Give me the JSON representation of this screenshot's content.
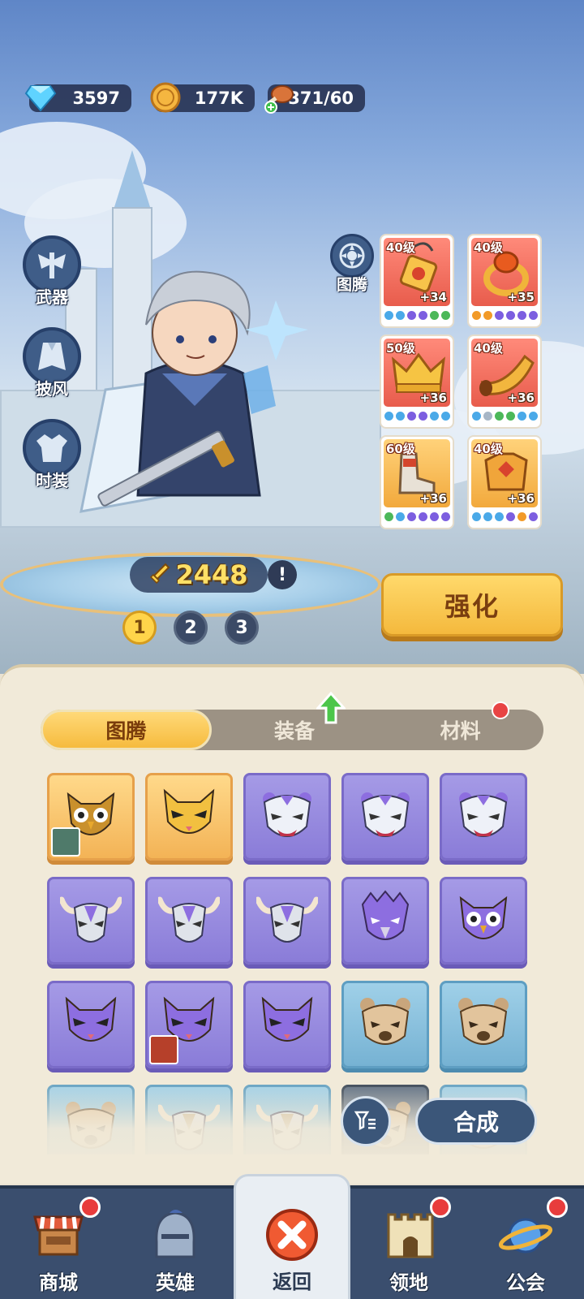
{
  "resources": {
    "diamonds": "3597",
    "gold": "177K",
    "stamina": "371/60"
  },
  "side_menu": {
    "weapon": "武器",
    "cloak": "披风",
    "costume": "时装",
    "totem": "图腾"
  },
  "equipment": [
    {
      "level": "40级",
      "bonus": "+34",
      "rarity": "red"
    },
    {
      "level": "40级",
      "bonus": "+35",
      "rarity": "red"
    },
    {
      "level": "50级",
      "bonus": "+36",
      "rarity": "red"
    },
    {
      "level": "40级",
      "bonus": "+36",
      "rarity": "red"
    },
    {
      "level": "60级",
      "bonus": "+36",
      "rarity": "gold"
    },
    {
      "level": "40级",
      "bonus": "+36",
      "rarity": "gold"
    }
  ],
  "power": "2448",
  "info": "!",
  "pages": [
    "1",
    "2",
    "3"
  ],
  "strengthen_label": "强化",
  "tabs": [
    "图腾",
    "装备",
    "材料"
  ],
  "grid": [
    {
      "mask": "owl",
      "tier": "orange",
      "hero": true
    },
    {
      "mask": "cat",
      "tier": "orange"
    },
    {
      "mask": "tiger",
      "tier": "purple"
    },
    {
      "mask": "tiger",
      "tier": "purple"
    },
    {
      "mask": "tiger",
      "tier": "purple"
    },
    {
      "mask": "bull",
      "tier": "purple"
    },
    {
      "mask": "bull",
      "tier": "purple"
    },
    {
      "mask": "bull",
      "tier": "purple"
    },
    {
      "mask": "eagle",
      "tier": "purple"
    },
    {
      "mask": "owl",
      "tier": "purple"
    },
    {
      "mask": "cat",
      "tier": "purple"
    },
    {
      "mask": "cat",
      "tier": "purple",
      "hero": true
    },
    {
      "mask": "cat",
      "tier": "purple"
    },
    {
      "mask": "bear",
      "tier": "blue"
    },
    {
      "mask": "bear",
      "tier": "blue"
    },
    {
      "mask": "bear",
      "tier": "blue"
    },
    {
      "mask": "bull",
      "tier": "blue"
    },
    {
      "mask": "bull",
      "tier": "blue"
    },
    {
      "mask": "bear",
      "tier": "dark"
    },
    {
      "mask": "bear",
      "tier": "blue"
    }
  ],
  "merge_label": "合成",
  "nav": [
    {
      "label": "商城",
      "icon": "shop-icon",
      "badge": true
    },
    {
      "label": "英雄",
      "icon": "helmet-icon",
      "badge": false
    },
    {
      "label": "返回",
      "icon": "close-icon",
      "badge": false,
      "active": true
    },
    {
      "label": "领地",
      "icon": "castle-icon",
      "badge": true
    },
    {
      "label": "公会",
      "icon": "planet-icon",
      "badge": true
    }
  ],
  "colors": {
    "accent_gold": "#f6bb3e",
    "panel": "#f1ead9",
    "nav": "#3a4e6e",
    "badge_red": "#e83c3c"
  }
}
